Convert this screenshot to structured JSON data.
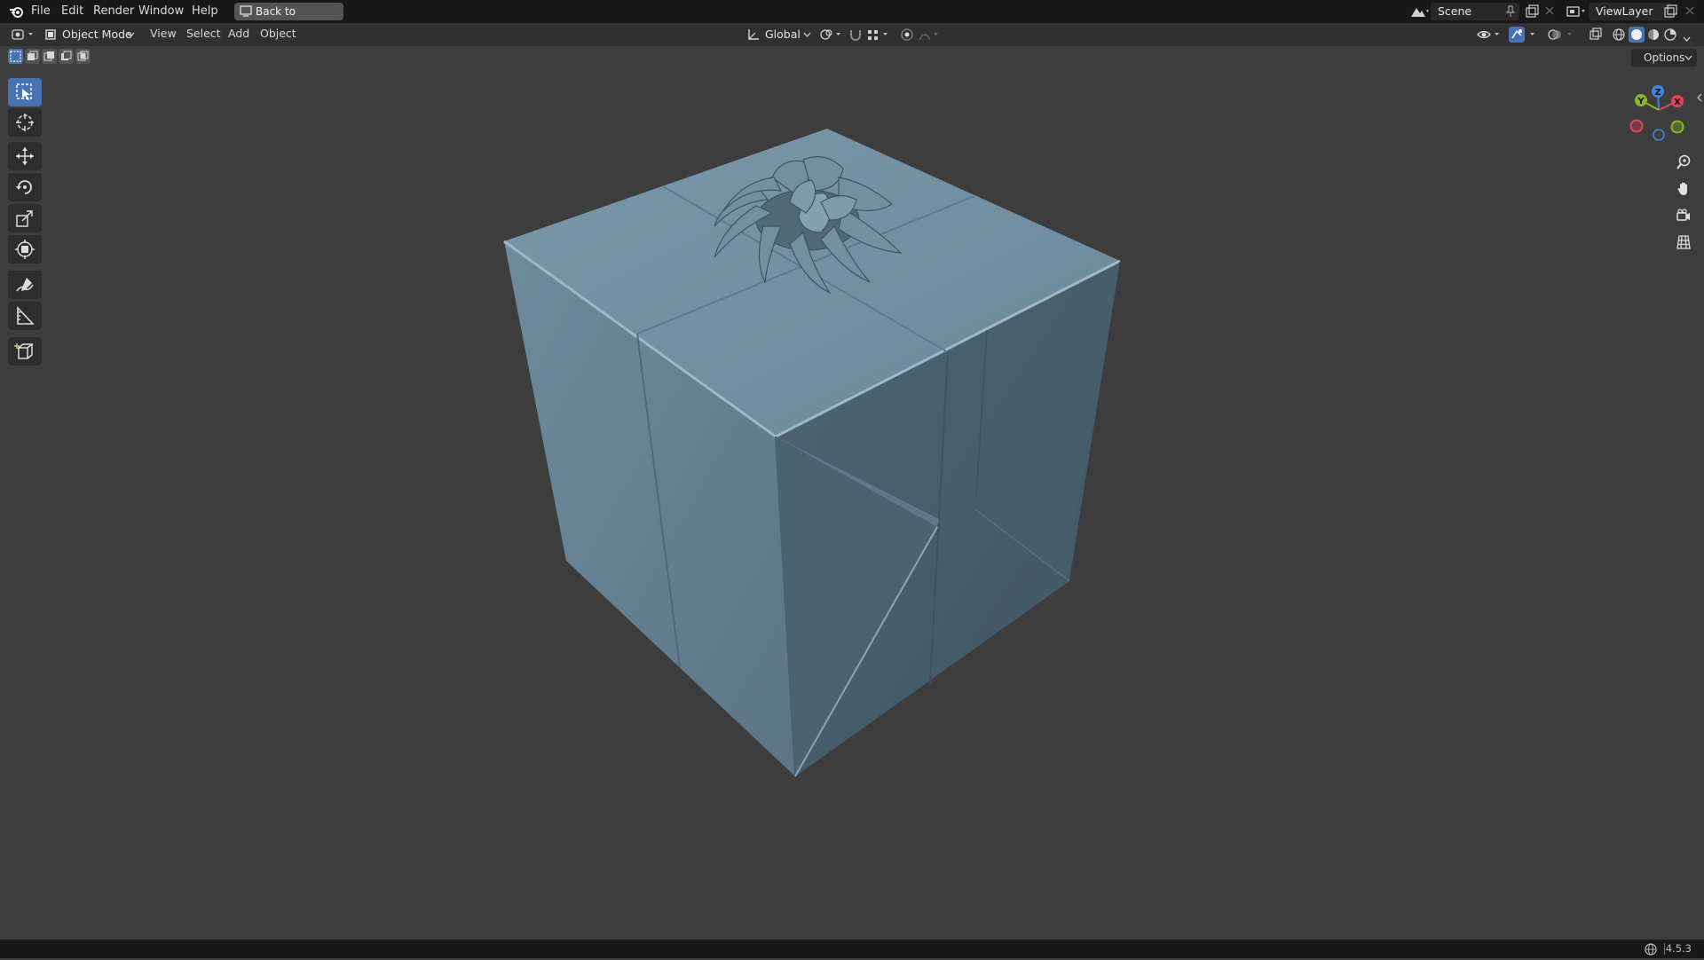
{
  "menubar": {
    "items": [
      "File",
      "Edit",
      "Render",
      "Window",
      "Help"
    ],
    "back_button": "Back to Previous",
    "scene_name": "Scene",
    "view_layer_name": "ViewLayer"
  },
  "header": {
    "mode": "Object Mode",
    "menus": [
      "View",
      "Select",
      "Add",
      "Object"
    ],
    "transform_orientation": "Global",
    "options_label": "Options"
  },
  "toolbar": {
    "tools": [
      "select-box-icon",
      "cursor-icon",
      "move-icon",
      "rotate-icon",
      "scale-icon",
      "transform-icon",
      "annotate-icon",
      "measure-icon",
      "add-cube-icon"
    ],
    "active_tool": "select-box-icon"
  },
  "gizmo": {
    "axes": [
      "X",
      "Y",
      "Z"
    ],
    "colors": {
      "x": "#e0455a",
      "y": "#8ab62c",
      "z": "#3f86dd"
    }
  },
  "scene": {
    "object": "gift box with bow",
    "color": "#6e8a9c"
  },
  "statusbar": {
    "version": "4.5.3"
  },
  "colors": {
    "accent": "#4772b3",
    "viewport_bg": "#3d3d3d",
    "topbar_bg": "#181818",
    "header_bg": "#303030"
  }
}
